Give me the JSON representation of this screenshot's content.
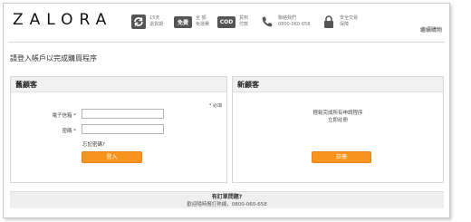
{
  "header": {
    "logo": "ZALORA",
    "usps": [
      {
        "icon": "refresh-icon",
        "line1": "15天",
        "line2": "退貨期"
      },
      {
        "icon": "free-shipping-badge",
        "badge": "免費",
        "line1": "全 額",
        "line2": "免運費"
      },
      {
        "icon": "cod-badge",
        "badge": "COD",
        "line1": "貨到",
        "line2": "付款"
      },
      {
        "icon": "phone-icon",
        "line1": "聯絡我們",
        "line2": "0800-060-658"
      },
      {
        "icon": "lock-icon",
        "line1": "安全交易",
        "line2": "保障"
      }
    ],
    "help": "繼續購物"
  },
  "page_title": "請登入帳戶以完成購買程序",
  "returning": {
    "heading": "舊顧客",
    "required_note": "* 必填",
    "email_label": "電子信箱 *",
    "email_value": "",
    "password_label": "密碼 *",
    "password_value": "",
    "forgot": "忘記密碼?",
    "login_button": "登入"
  },
  "new_customer": {
    "heading": "新顧客",
    "msg_line1": "輕鬆完成所有申請程序",
    "msg_line2": "立即註冊",
    "register_button": "註冊"
  },
  "footer": {
    "question": "有訂單問題?",
    "contact": "歡迎隨時撥打熱線，0800-060-658"
  },
  "colors": {
    "accent": "#f7941d",
    "panel_head": "#f1f1f1"
  }
}
